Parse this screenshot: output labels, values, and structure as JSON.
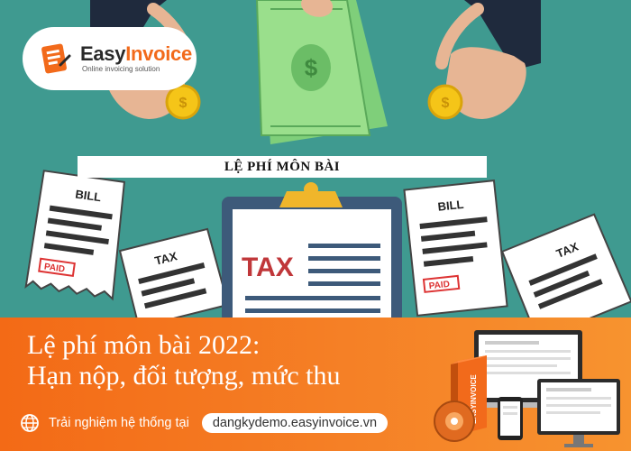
{
  "logo": {
    "brand_part1": "Easy",
    "brand_part2": "Invoice",
    "tagline": "Online invoicing solution"
  },
  "scene": {
    "title": "LỆ PHÍ MÔN BÀI",
    "bill_label": "BILL",
    "tax_label": "TAX",
    "paid_label": "PAID",
    "clipboard_label": "TAX",
    "money_symbol": "$"
  },
  "banner": {
    "headline_line1": "Lệ phí môn bài 2022:",
    "headline_line2": "Hạn nộp, đối tượng, mức thu",
    "cta_text": "Trải nghiệm hệ thống tại",
    "cta_link": "dangkydemo.easyinvoice.vn",
    "product_box_label": "EASYINVOICE"
  },
  "colors": {
    "background": "#3f9a90",
    "brand_orange": "#f26a1b",
    "coin": "#f5c518"
  }
}
